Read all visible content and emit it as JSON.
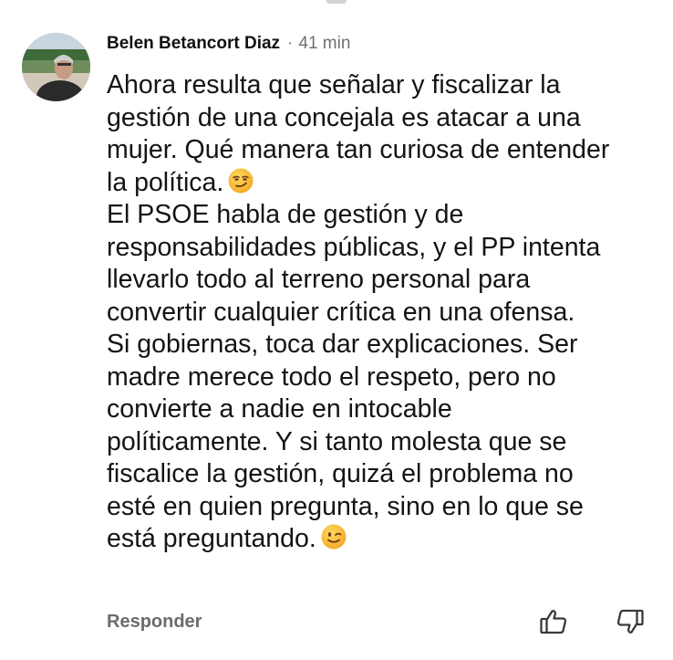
{
  "comment": {
    "author": "Belen Betancort Diaz",
    "separator": "·",
    "time": "41 min",
    "body_lines": [
      "Ahora resulta que señalar y fiscalizar la",
      "gestión de una concejala es atacar a una",
      "mujer. Qué manera tan curiosa de entender",
      "la política.",
      "El PSOE habla de gestión y de",
      "responsabilidades públicas, y el PP intenta",
      "llevarlo todo al terreno personal para",
      "convertir cualquier crítica en una ofensa.",
      "Si gobiernas, toca dar explicaciones. Ser",
      "madre merece todo el respeto, pero no",
      "convierte a nadie en intocable",
      "políticamente. Y si tanto molesta que se",
      "fiscalice la gestión, quizá el problema no",
      "esté en quien pregunta, sino en lo que se",
      "está preguntando."
    ],
    "emojis": [
      "smirking-face",
      "winking-face"
    ],
    "actions": {
      "reply_label": "Responder",
      "like_icon": "thumbs-up-icon",
      "dislike_icon": "thumbs-down-icon"
    }
  },
  "colors": {
    "author": "#111111",
    "meta": "#707070",
    "body": "#141414",
    "action": "#6b6b6b",
    "emoji": "#f6c12c"
  }
}
